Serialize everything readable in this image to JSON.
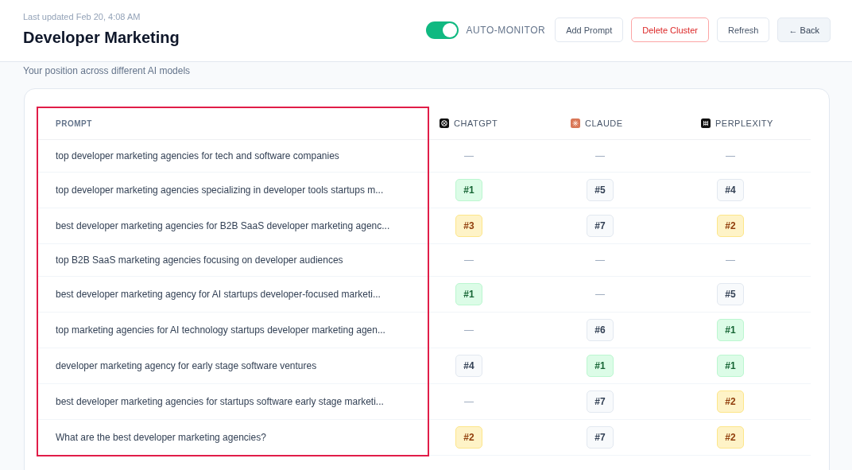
{
  "header": {
    "updated": "Last updated Feb 20, 4:08 AM",
    "title": "Developer Marketing",
    "auto_monitor": {
      "label": "AUTO-MONITOR",
      "on": true
    },
    "buttons": [
      {
        "label": "Add Prompt",
        "kind": "plain"
      },
      {
        "label": "Delete Cluster",
        "kind": "danger"
      },
      {
        "label": "Refresh",
        "kind": "plain"
      },
      {
        "label": "← Back",
        "kind": "muted"
      }
    ]
  },
  "subtitle": "Your position across different AI models",
  "table": {
    "columns": [
      {
        "label": "PROMPT"
      },
      {
        "label": "CHATGPT"
      },
      {
        "label": "CLAUDE"
      },
      {
        "label": "PERPLEXITY"
      }
    ],
    "rows": [
      {
        "prompt": "top developer marketing agencies for tech and software companies",
        "ranks": [
          {
            "kind": "empty",
            "text": "—"
          },
          {
            "kind": "empty",
            "text": "—"
          },
          {
            "kind": "empty",
            "text": "—"
          }
        ]
      },
      {
        "prompt": "top developer marketing agencies specializing in developer tools startups m...",
        "ranks": [
          {
            "kind": "green",
            "text": "#1"
          },
          {
            "kind": "gray",
            "text": "#5"
          },
          {
            "kind": "gray",
            "text": "#4"
          }
        ]
      },
      {
        "prompt": "best developer marketing agencies for B2B SaaS developer marketing agenc...",
        "ranks": [
          {
            "kind": "amber",
            "text": "#3"
          },
          {
            "kind": "gray",
            "text": "#7"
          },
          {
            "kind": "amber",
            "text": "#2"
          }
        ]
      },
      {
        "prompt": "top B2B SaaS marketing agencies focusing on developer audiences",
        "ranks": [
          {
            "kind": "empty",
            "text": "—"
          },
          {
            "kind": "empty",
            "text": "—"
          },
          {
            "kind": "empty",
            "text": "—"
          }
        ]
      },
      {
        "prompt": "best developer marketing agency for AI startups developer-focused marketi...",
        "ranks": [
          {
            "kind": "green",
            "text": "#1"
          },
          {
            "kind": "empty",
            "text": "—"
          },
          {
            "kind": "gray",
            "text": "#5"
          }
        ]
      },
      {
        "prompt": "top marketing agencies for AI technology startups developer marketing agen...",
        "ranks": [
          {
            "kind": "empty",
            "text": "—"
          },
          {
            "kind": "gray",
            "text": "#6"
          },
          {
            "kind": "green",
            "text": "#1"
          }
        ]
      },
      {
        "prompt": "developer marketing agency for early stage software ventures",
        "ranks": [
          {
            "kind": "gray",
            "text": "#4"
          },
          {
            "kind": "green",
            "text": "#1"
          },
          {
            "kind": "green",
            "text": "#1"
          }
        ]
      },
      {
        "prompt": "best developer marketing agencies for startups software early stage marketi...",
        "ranks": [
          {
            "kind": "empty",
            "text": "—"
          },
          {
            "kind": "gray",
            "text": "#7"
          },
          {
            "kind": "amber",
            "text": "#2"
          }
        ]
      },
      {
        "prompt": "What are the best developer marketing agencies?",
        "ranks": [
          {
            "kind": "amber",
            "text": "#2"
          },
          {
            "kind": "gray",
            "text": "#7"
          },
          {
            "kind": "amber",
            "text": "#2"
          }
        ]
      }
    ]
  }
}
